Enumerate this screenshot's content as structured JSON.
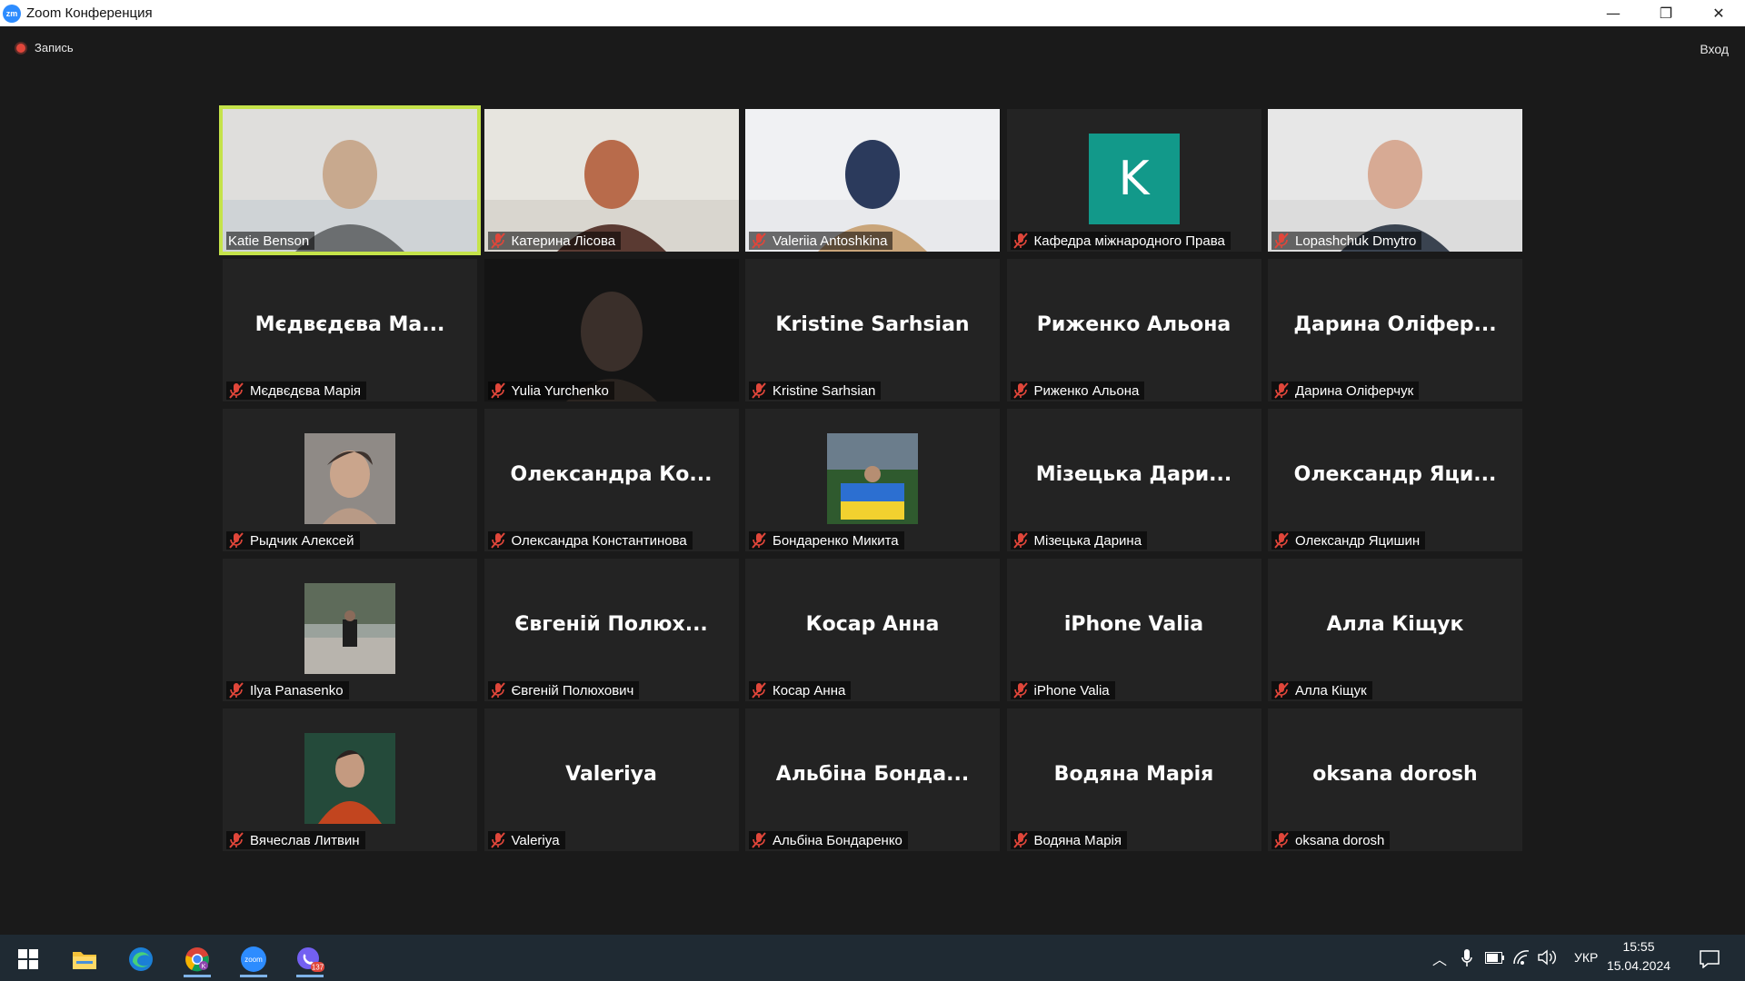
{
  "window": {
    "logo_text": "zm",
    "title": "Zoom Конференция",
    "minimize": "—",
    "restore": "❐",
    "close": "✕"
  },
  "meeting": {
    "recording_label": "Запись",
    "sign_in_label": "Вход",
    "speaker_color": "#c5e34a",
    "mic_muted_color": "#e0463a"
  },
  "participants": [
    {
      "display": "Katie Benson",
      "label": "Katie Benson",
      "type": "video",
      "muted": false,
      "active": true
    },
    {
      "display": "Катерина Лісова",
      "label": "Катерина Лісова",
      "type": "video",
      "muted": true
    },
    {
      "display": "Valeriia Antoshkina",
      "label": "Valeriia Antoshkina",
      "type": "video",
      "muted": true
    },
    {
      "display": "K",
      "label": "Кафедра міжнародного Права",
      "type": "letter-avatar",
      "muted": true,
      "avatar_color": "#12998a"
    },
    {
      "display": "Lopashchuk Dmytro",
      "label": "Lopashchuk Dmytro",
      "type": "video",
      "muted": true
    },
    {
      "display": "Мєдвєдєва Ма...",
      "label": "Мєдвєдєва Марія",
      "type": "name",
      "muted": true
    },
    {
      "display": "Yulia Yurchenko",
      "label": "Yulia Yurchenko",
      "type": "video-dark",
      "muted": true
    },
    {
      "display": "Kristine Sarhsian",
      "label": "Kristine Sarhsian",
      "type": "name",
      "muted": true
    },
    {
      "display": "Риженко Альона",
      "label": "Риженко Альона",
      "type": "name",
      "muted": true
    },
    {
      "display": "Дарина Оліфер...",
      "label": "Дарина Оліферчук",
      "type": "name",
      "muted": true
    },
    {
      "display": "Рыдчик Алексей",
      "label": "Рыдчик Алексей",
      "type": "photo",
      "muted": true
    },
    {
      "display": "Олександра Ко...",
      "label": "Олександра Константинова",
      "type": "name",
      "muted": true
    },
    {
      "display": "Бондаренко Микита",
      "label": "Бондаренко Микита",
      "type": "photo-flag",
      "muted": true
    },
    {
      "display": "Мізецька Дари...",
      "label": "Мізецька Дарина",
      "type": "name",
      "muted": true
    },
    {
      "display": "Олександр Яци...",
      "label": "Олександр Яцишин",
      "type": "name",
      "muted": true
    },
    {
      "display": "Ilya Panasenko",
      "label": "Ilya Panasenko",
      "type": "photo-street",
      "muted": true
    },
    {
      "display": "Євгеній Полюх...",
      "label": "Євгеній Полюхович",
      "type": "name",
      "muted": true
    },
    {
      "display": "Косар Анна",
      "label": "Косар Анна",
      "type": "name",
      "muted": true
    },
    {
      "display": "iPhone Valia",
      "label": "iPhone Valia",
      "type": "name",
      "muted": true
    },
    {
      "display": "Алла Кіщук",
      "label": "Алла Кіщук",
      "type": "name",
      "muted": true
    },
    {
      "display": "Вячеслав Литвин",
      "label": "Вячеслав Литвин",
      "type": "photo-red",
      "muted": true
    },
    {
      "display": "Valeriya",
      "label": "Valeriya",
      "type": "name",
      "muted": true
    },
    {
      "display": "Альбіна Бонда...",
      "label": "Альбіна Бондаренко",
      "type": "name",
      "muted": true
    },
    {
      "display": "Водяна Марія",
      "label": "Водяна Марія",
      "type": "name",
      "muted": true
    },
    {
      "display": "oksana dorosh",
      "label": "oksana dorosh",
      "type": "name",
      "muted": true
    }
  ],
  "taskbar": {
    "apps": [
      {
        "name": "windows-start-icon"
      },
      {
        "name": "file-explorer-icon"
      },
      {
        "name": "edge-browser-icon"
      },
      {
        "name": "chrome-browser-icon",
        "active": true
      },
      {
        "name": "zoom-app-icon",
        "active": true,
        "text": "zoom"
      },
      {
        "name": "viber-app-icon",
        "active": true,
        "badge": "137"
      }
    ],
    "language": "УКР",
    "time": "15:55",
    "date": "15.04.2024"
  }
}
